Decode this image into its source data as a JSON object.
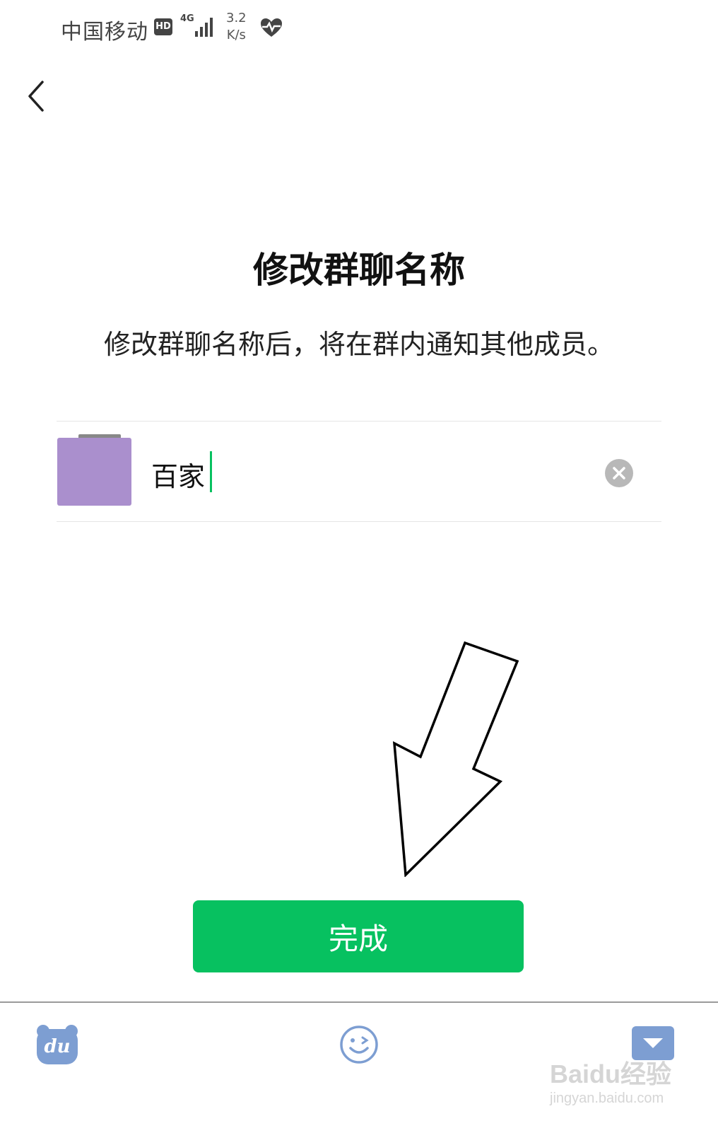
{
  "status_bar": {
    "carrier": "中国移动",
    "hd_badge": "HD",
    "network_type": "4G",
    "speed_value": "3.2",
    "speed_unit": "K/s",
    "signal_icon": "signal-bars-icon",
    "heart_icon": "heart-pulse-icon"
  },
  "nav": {
    "back_icon": "chevron-left-icon"
  },
  "main": {
    "title": "修改群聊名称",
    "subtitle": "修改群聊名称后，将在群内通知其他成员。",
    "group_name_value": "百家",
    "clear_icon": "clear-circle-icon"
  },
  "done_button": {
    "label": "完成",
    "color": "#07c160"
  },
  "keyboard_toolbar": {
    "du_logo_text": "du",
    "emoji_icon": "smiley-wink-icon",
    "hide_keyboard_icon": "keyboard-hide-icon"
  },
  "watermark": {
    "main": "Baidu经验",
    "sub": "jingyan.baidu.com"
  },
  "colors": {
    "accent": "#07c160",
    "avatar": "#aa8fcd",
    "toolbar_icon": "#7d9ed2"
  }
}
